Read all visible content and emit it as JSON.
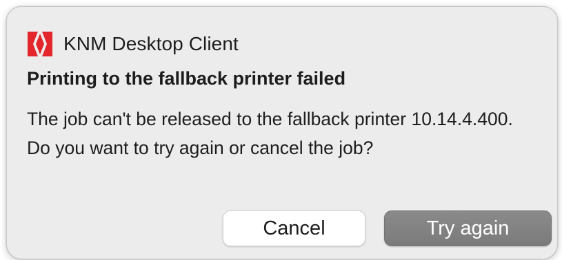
{
  "app": {
    "name": "KNM Desktop Client",
    "icon": "knm-app-logo-icon",
    "brand_color": "#e3262c"
  },
  "dialog": {
    "title": "Printing to the fallback printer failed",
    "message": "The job can't be released to the fallback printer 10.14.4.400. Do you want to try again or cancel the job?"
  },
  "buttons": {
    "cancel_label": "Cancel",
    "primary_label": "Try again",
    "primary_color": "#828282"
  }
}
